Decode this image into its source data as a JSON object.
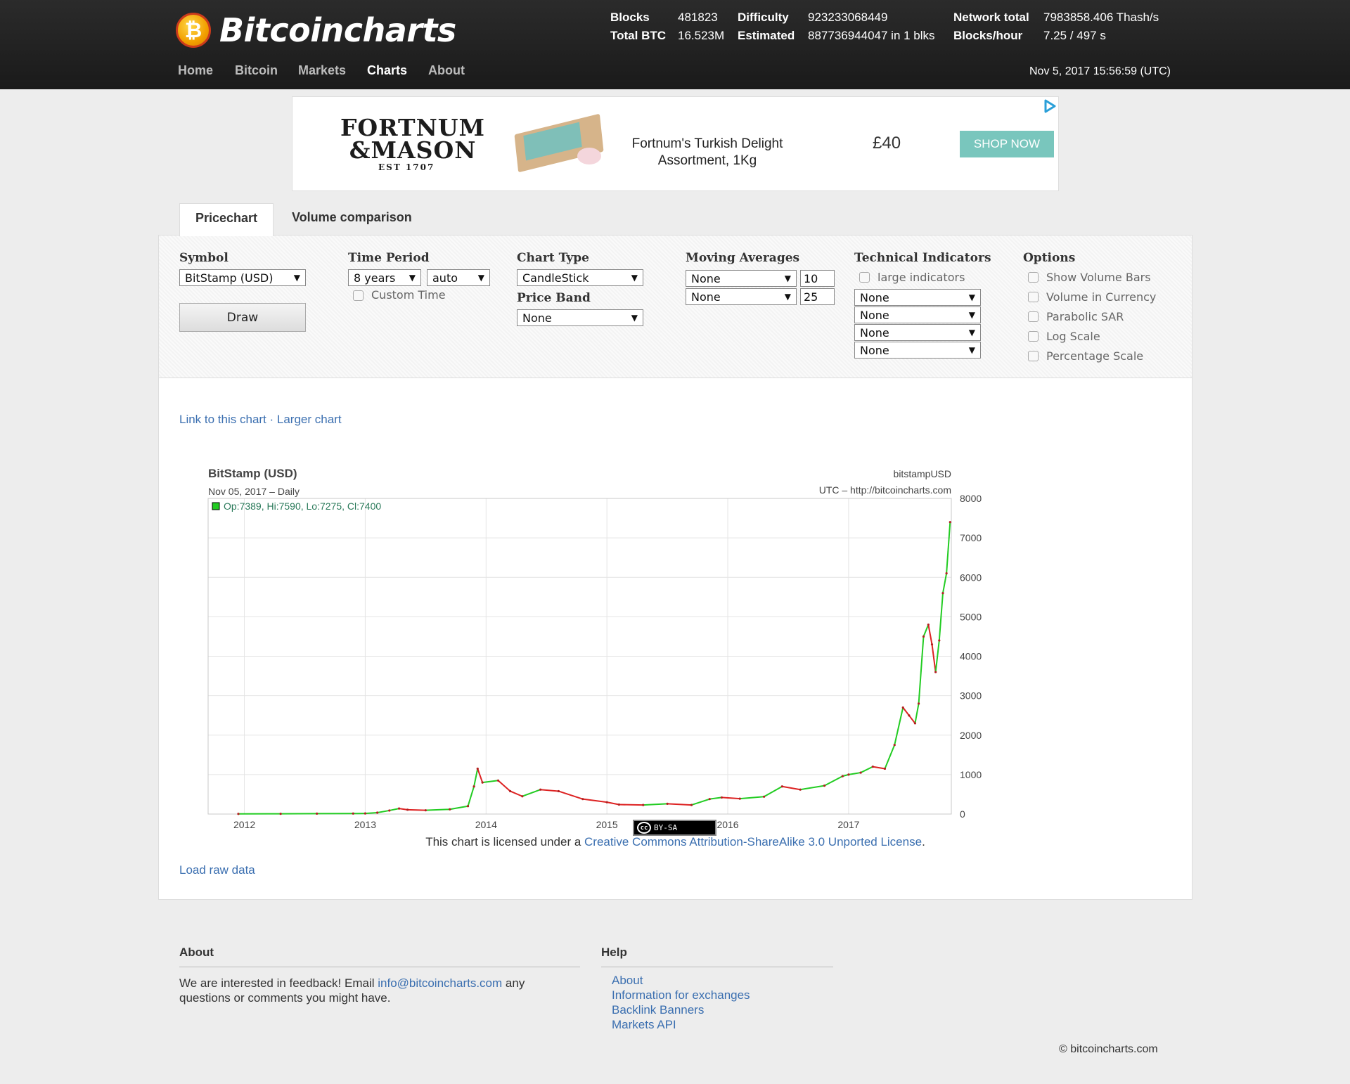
{
  "brand": {
    "logo_glyph": "₿",
    "name": "Bitcoincharts"
  },
  "nav": [
    "Home",
    "Bitcoin",
    "Markets",
    "Charts",
    "About"
  ],
  "stats": {
    "blocks_label": "Blocks",
    "blocks_value": "481823",
    "difficulty_label": "Difficulty",
    "difficulty_value": "923233068449",
    "network_label": "Network total",
    "network_value": "7983858.406 Thash/s",
    "totalbtc_label": "Total BTC",
    "totalbtc_value": "16.523M",
    "estimated_label": "Estimated",
    "estimated_value": "887736944047 in 1 blks",
    "bph_label": "Blocks/hour",
    "bph_value": "7.25 / 497 s"
  },
  "timestamp": "Nov 5, 2017 15:56:59 (UTC)",
  "ad": {
    "brand_line1": "FORTNUM",
    "brand_line2": "&MASON",
    "brand_est": "EST 1707",
    "title": "Fortnum's Turkish Delight Assortment, 1Kg",
    "price": "£40",
    "cta": "SHOP NOW"
  },
  "tabs": [
    "Pricechart",
    "Volume comparison"
  ],
  "controls": {
    "symbol_label": "Symbol",
    "symbol_value": "BitStamp (USD)",
    "draw_label": "Draw",
    "time_label": "Time Period",
    "time_value": "8 years",
    "interval_value": "auto",
    "custom_time_label": "Custom Time",
    "charttype_label": "Chart Type",
    "charttype_value": "CandleStick",
    "priceband_label": "Price Band",
    "priceband_value": "None",
    "ma_label": "Moving Averages",
    "ma1_value": "None",
    "ma1_period": "10",
    "ma2_value": "None",
    "ma2_period": "25",
    "ti_label": "Technical Indicators",
    "large_indicators_label": "large indicators",
    "ti_values": [
      "None",
      "None",
      "None",
      "None"
    ],
    "options_label": "Options",
    "options": [
      "Show Volume Bars",
      "Volume in Currency",
      "Parabolic SAR",
      "Log Scale",
      "Percentage Scale"
    ]
  },
  "links": {
    "link_chart": "Link to this chart",
    "separator": " · ",
    "larger_chart": "Larger chart",
    "load_raw": "Load raw data"
  },
  "license": {
    "badge_cc": "cc",
    "badge_text": "BY-SA",
    "prefix": "This chart is licensed under a ",
    "link": "Creative Commons Attribution-ShareAlike 3.0 Unported License",
    "suffix": "."
  },
  "chart_data": {
    "type": "line",
    "title": "BitStamp (USD)",
    "subtitle": "Nov 05, 2017 – Daily",
    "symbol_label": "bitstampUSD",
    "source_label": "UTC – http://bitcoincharts.com",
    "ohlc_label": "Op:7389, Hi:7590, Lo:7275, Cl:7400",
    "x_tick_labels": [
      "2012",
      "2013",
      "2014",
      "2015",
      "2016",
      "2017"
    ],
    "y_ticks": [
      0,
      1000,
      2000,
      3000,
      4000,
      5000,
      6000,
      7000,
      8000
    ],
    "ylim": [
      0,
      8000
    ],
    "xlim": [
      2011.7,
      2017.85
    ],
    "colors": {
      "up": "#22cc22",
      "down": "#dd2222",
      "grid": "#e4e4e4"
    },
    "series": [
      {
        "x": [
          2011.95,
          2012.3,
          2012.6,
          2012.9,
          2013.0,
          2013.1,
          2013.2,
          2013.28,
          2013.35,
          2013.5,
          2013.7,
          2013.85,
          2013.9,
          2013.93,
          2013.97,
          2014.1,
          2014.2,
          2014.3,
          2014.45,
          2014.6,
          2014.8,
          2015.0,
          2015.1,
          2015.3,
          2015.5,
          2015.7,
          2015.85,
          2015.95,
          2016.1,
          2016.3,
          2016.45,
          2016.6,
          2016.8,
          2016.95,
          2017.0,
          2017.1,
          2017.2,
          2017.3,
          2017.38,
          2017.45,
          2017.5,
          2017.55,
          2017.58,
          2017.62,
          2017.66,
          2017.69,
          2017.72,
          2017.75,
          2017.78,
          2017.81,
          2017.84
        ],
        "y": [
          5,
          7,
          11,
          13,
          15,
          35,
          90,
          140,
          110,
          95,
          120,
          200,
          700,
          1150,
          800,
          850,
          580,
          450,
          620,
          580,
          380,
          300,
          240,
          230,
          260,
          230,
          380,
          420,
          390,
          440,
          700,
          620,
          720,
          960,
          1000,
          1050,
          1200,
          1150,
          1750,
          2700,
          2500,
          2300,
          2800,
          4500,
          4800,
          4300,
          3600,
          4400,
          5600,
          6100,
          7400
        ]
      }
    ]
  },
  "footer": {
    "about_head": "About",
    "about_text": "We are interested in feedback! Email",
    "about_email": "info@bitcoincharts.com",
    "about_suffix": "any questions or comments you might have.",
    "help_head": "Help",
    "help_links": [
      "About",
      "Information for exchanges",
      "Backlink Banners",
      "Markets API"
    ],
    "copyright": "© bitcoincharts.com"
  }
}
